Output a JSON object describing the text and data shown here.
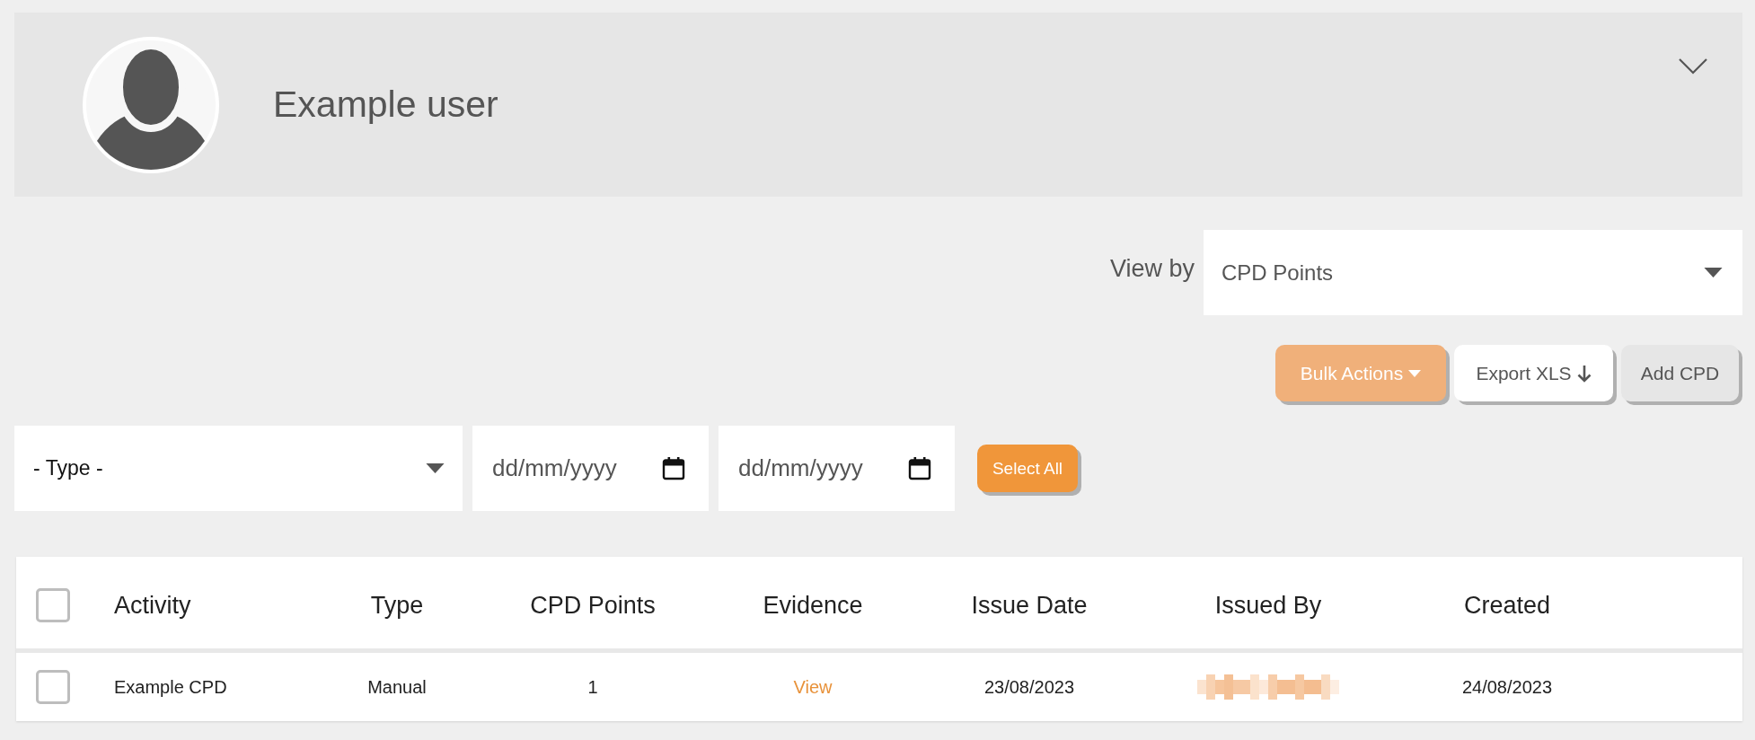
{
  "header": {
    "user_name": "Example user",
    "expanded": false
  },
  "view_by": {
    "label": "View by",
    "value": "CPD Points"
  },
  "actions": [
    {
      "label": "Bulk Actions",
      "kind": "menu"
    },
    {
      "label": "Export XLS",
      "kind": "download"
    },
    {
      "label": "Add CPD",
      "kind": "plain"
    }
  ],
  "filters": {
    "type": {
      "value": "- Type -"
    },
    "dates": [
      {
        "placeholder": "dd/mm/yyyy"
      },
      {
        "placeholder": "dd/mm/yyyy"
      }
    ],
    "select_all": "Select All"
  },
  "table": {
    "header_checked": false,
    "columns": [
      "Activity",
      "Type",
      "CPD Points",
      "Evidence",
      "Issue Date",
      "Issued By",
      "Created"
    ],
    "rows": [
      {
        "checked": false,
        "cells": [
          {
            "kind": "text",
            "text": "Example CPD"
          },
          {
            "kind": "text",
            "text": "Manual"
          },
          {
            "kind": "text",
            "text": "1"
          },
          {
            "kind": "link",
            "text": "View"
          },
          {
            "kind": "text",
            "text": "23/08/2023"
          },
          {
            "kind": "redacted"
          },
          {
            "kind": "text",
            "text": "24/08/2023"
          }
        ]
      }
    ]
  }
}
